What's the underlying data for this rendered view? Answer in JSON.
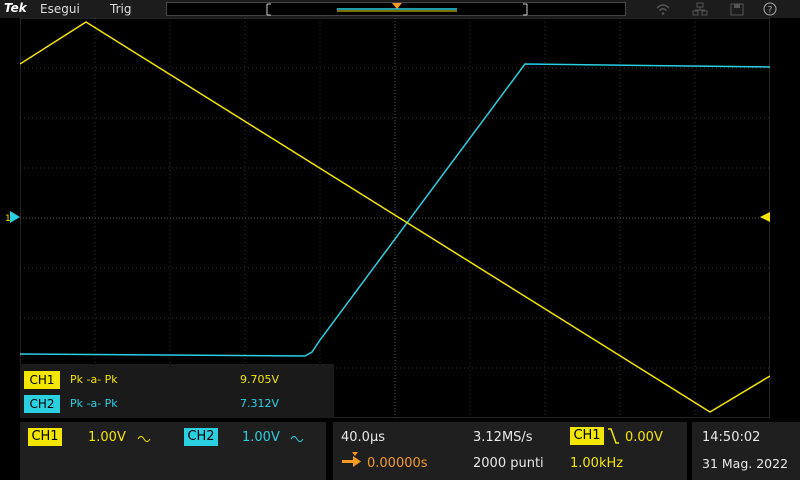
{
  "menu": {
    "logo": "Tek",
    "run": "Esegui",
    "trig": "Trig"
  },
  "measurements": [
    {
      "channel": "CH1",
      "name": "Pk -a- Pk",
      "value": "9.705V"
    },
    {
      "channel": "CH2",
      "name": "Pk -a- Pk",
      "value": "7.312V"
    }
  ],
  "channels": [
    {
      "label": "CH1",
      "scale": "1.00V"
    },
    {
      "label": "CH2",
      "scale": "1.00V"
    }
  ],
  "horizontal": {
    "time_per_div": "40.0μs",
    "position": "0.00000s",
    "sample_rate": "3.12MS/s",
    "record_length": "2000 punti"
  },
  "trigger": {
    "source": "CH1",
    "level": "0.00V",
    "frequency": "1.00kHz",
    "marker": "T"
  },
  "clock": {
    "time": "14:50:02",
    "date": "31 Mag. 2022"
  },
  "colors": {
    "ch1": "#f2e600",
    "ch2": "#2ad0e0",
    "trigger": "#f39a1f"
  },
  "icons": [
    "wifi-icon",
    "network-icon",
    "save-icon",
    "help-icon"
  ]
}
